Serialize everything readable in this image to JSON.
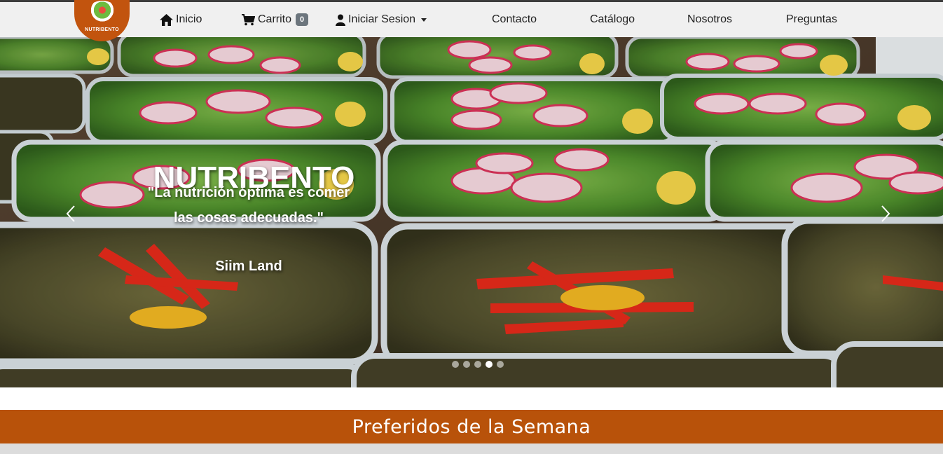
{
  "brand": {
    "logo_text": "NUTRIBENTO"
  },
  "nav": {
    "inicio": "Inicio",
    "carrito": "Carrito",
    "cart_count": "0",
    "login": "Iniciar Sesion",
    "contacto": "Contacto",
    "catalogo": "Catálogo",
    "nosotros": "Nosotros",
    "preguntas": "Preguntas"
  },
  "carousel": {
    "title": "NUTRIBENTO",
    "quote": "\"La nutrición óptima es comer las cosas adecuadas.\"",
    "author": "Siim Land",
    "active_slide": 4,
    "slide_count": 5
  },
  "section": {
    "title": "Preferidos de la Semana"
  },
  "colors": {
    "brand_orange": "#b8520a",
    "navbar_bg": "#f0f0f0"
  }
}
